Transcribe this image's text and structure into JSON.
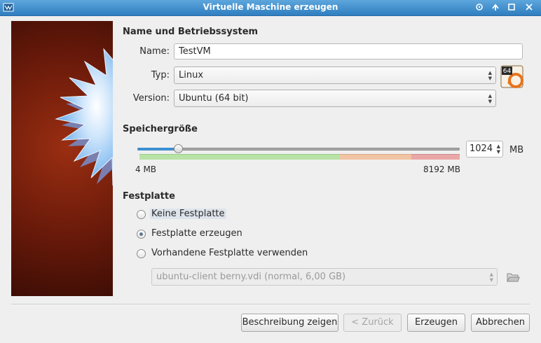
{
  "window": {
    "title": "Virtuelle Maschine erzeugen"
  },
  "name_os": {
    "section_title": "Name und Betriebssystem",
    "name_label": "Name:",
    "name_value": "TestVM",
    "type_label": "Typ:",
    "type_value": "Linux",
    "version_label": "Version:",
    "version_value": "Ubuntu (64 bit)",
    "os_badge": "64"
  },
  "memory": {
    "section_title": "Speichergröße",
    "value": "1024",
    "unit": "MB",
    "min_label": "4 MB",
    "max_label": "8192 MB",
    "slider_fraction": 0.125
  },
  "disk": {
    "section_title": "Festplatte",
    "options": [
      "Keine Festplatte",
      "Festplatte erzeugen",
      "Vorhandene Festplatte verwenden"
    ],
    "selected_index": 1,
    "existing_disk_value": "ubuntu-client berny.vdi (normal, 6,00 GB)"
  },
  "buttons": {
    "description": "Beschreibung zeigen",
    "back": "< Zurück",
    "create": "Erzeugen",
    "cancel": "Abbrechen"
  },
  "colors": {
    "titlebar": "#2f7ec0",
    "slider_accent": "#3c8fd0",
    "banner_background": "#6a1a0a",
    "zone_green": "#b9e3a6",
    "zone_orange": "#f1c4a3",
    "zone_red": "#eaa7a7"
  },
  "icons": [
    "app-icon",
    "help-icon",
    "maximize-icon",
    "restore-icon",
    "close-icon",
    "os-ubuntu-64-icon",
    "folder-open-icon",
    "starburst-logo"
  ]
}
